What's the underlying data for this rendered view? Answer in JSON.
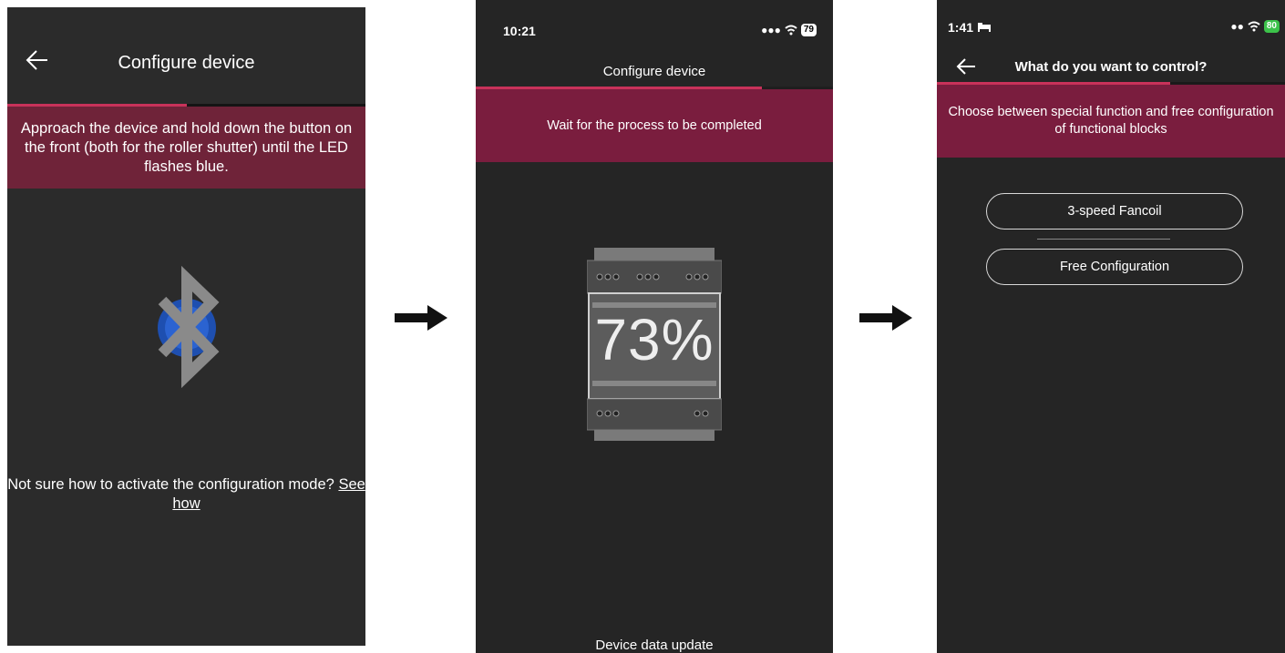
{
  "screen1": {
    "title": "Configure device",
    "progress": 0.5,
    "banner_text": "Approach the device and hold down the button on the front (both for the roller shutter) until the LED flashes blue.",
    "icon": "bluetooth-icon",
    "help_text": "Not sure how to activate the configuration mode?",
    "help_link": "See how"
  },
  "screen2": {
    "status_time": "10:21",
    "battery": "79",
    "title": "Configure device",
    "progress": 0.8,
    "banner_text": "Wait for the process to be completed",
    "percent_text": "73%",
    "footer_text": "Device data update"
  },
  "screen3": {
    "status_time": "1:41",
    "battery": "80",
    "title": "What do you want to control?",
    "progress": 0.67,
    "banner_text": "Choose between special function and free configuration of functional blocks",
    "option1": "3-speed Fancoil",
    "option2": "Free Configuration"
  },
  "colors": {
    "accent": "#c8325a",
    "banner": "#7a1d3e",
    "background": "#252525"
  }
}
